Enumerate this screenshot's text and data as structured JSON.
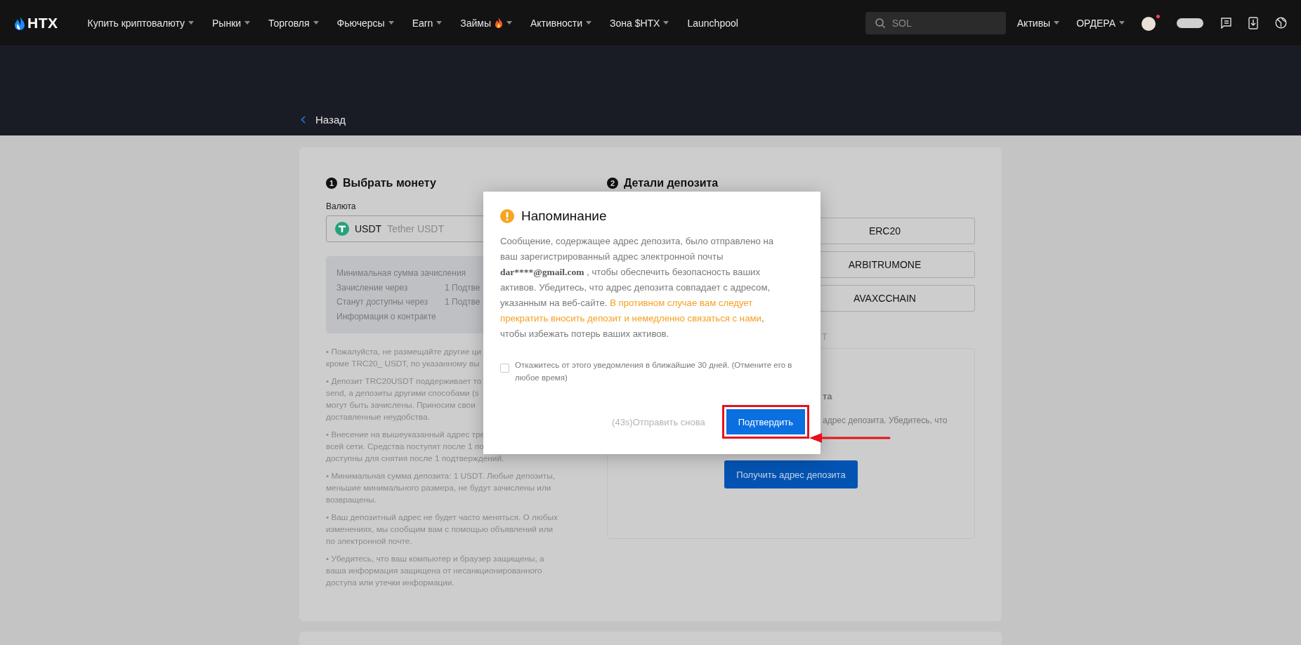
{
  "nav": {
    "logo": "HTX",
    "items": [
      {
        "label": "Купить криптовалюту",
        "dropdown": true
      },
      {
        "label": "Рынки",
        "dropdown": true
      },
      {
        "label": "Торговля",
        "dropdown": true
      },
      {
        "label": "Фьючерсы",
        "dropdown": true
      },
      {
        "label": "Earn",
        "dropdown": true
      },
      {
        "label": "Займы",
        "dropdown": true,
        "kind": "hot"
      },
      {
        "label": "Активности",
        "dropdown": true
      },
      {
        "label": "Зона $HTX",
        "dropdown": true
      },
      {
        "label": "Launchpool",
        "dropdown": false
      }
    ],
    "search": {
      "placeholder": "SOL"
    },
    "right_items": [
      {
        "label": "Активы",
        "dropdown": true
      },
      {
        "label": "ОРДЕРА",
        "dropdown": true
      }
    ],
    "notification_dot": true
  },
  "back": {
    "label": "Назад"
  },
  "coin_panel": {
    "step": "1",
    "title": "Выбрать монету",
    "currency_label": "Валюта",
    "currency": {
      "symbol": "USDT",
      "name": "Tether USDT"
    },
    "info_rows": [
      {
        "label": "Минимальная сумма зачисления"
      },
      {
        "label": "Зачисление через",
        "value": "1 Подтве"
      },
      {
        "label": "Станут доступны через",
        "value": "1 Подтве"
      },
      {
        "label": "Информация о контракте"
      }
    ],
    "notes": [
      [
        "• Пожалуйста, не размещайте другие ци",
        "кроме TRC20_ USDT, по указанному вы"
      ],
      [
        "• Депозит TRC20USDT поддерживает то",
        "send, а депозиты другими способами (s",
        "могут быть зачислены. Приносим свои",
        "доставленные неудобства."
      ],
      [
        "• Внесение на вышеуказанный адрес тре",
        "всей сети. Средства поступят после 1 по",
        "доступны для снятия после 1 подтверждений."
      ],
      [
        "• Минимальная сумма депозита: 1 USDT. Любые депозиты,",
        "меньшие минимального размера, не будут зачислены или",
        "возвращены."
      ],
      [
        "• Ваш депозитный адрес не будет часто меняться. О любых",
        "изменениях, мы сообщим вам с помощью объявлений или",
        "по электронной почте."
      ],
      [
        "• Убедитесь, что ваш компьютер и браузер защищены, а",
        "ваша информация защищена от несанкционированного",
        "доступа или утечки информации."
      ]
    ]
  },
  "deposit_panel": {
    "step": "2",
    "title": "Детали депозита",
    "networks": [
      {
        "label": "ERC20"
      },
      {
        "label": "ARBITRUMONE"
      },
      {
        "label": "AVAXCCHAIN"
      }
    ],
    "label_fragment": "T",
    "box": {
      "title_fragment": "та",
      "text_fragment": "адрес депозита. Убедитесь, что",
      "button": "Получить адрес депозита"
    }
  },
  "modal": {
    "title": "Напоминание",
    "body": [
      {
        "kind": "text",
        "text": "Сообщение, содержащее адрес депозита, было отправлено на ваш зарегистрированный адрес электронной почты "
      },
      {
        "kind": "email",
        "text": "dar****@gmail.com"
      },
      {
        "kind": "text",
        "text": " , чтобы обеспечить безопасность ваших активов. Убедитесь, что адрес депозита совпадает с адресом, указанным на веб-сайте. "
      },
      {
        "kind": "warning",
        "text": "В противном случае вам следует прекратить вносить депозит и немедленно связаться с нами"
      },
      {
        "kind": "text",
        "text": ", чтобы избежать потерь ваших активов."
      }
    ],
    "checkbox": {
      "label": "Откажитесь от этого уведомления в ближайшие 30 дней. (Отмените его в любое время)",
      "checked": false
    },
    "resend": {
      "label": "(43s)Отправить снова",
      "disabled": true
    },
    "confirm": "Подтвердить"
  }
}
